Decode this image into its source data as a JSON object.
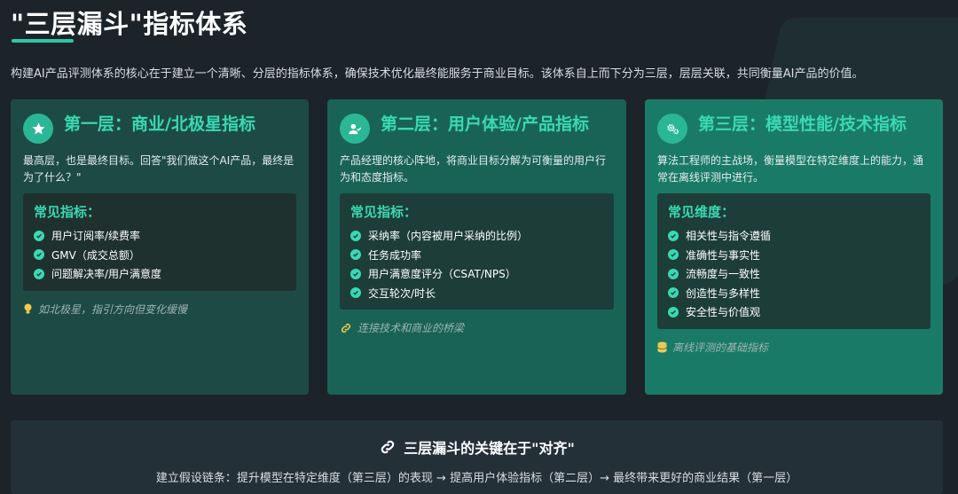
{
  "header": {
    "title": "\"三层漏斗\"指标体系",
    "intro": "构建AI产品评测体系的核心在于建立一个清晰、分层的指标体系，确保技术优化最终能服务于商业目标。该体系自上而下分为三层，层层关联，共同衡量AI产品的价值。"
  },
  "colors": {
    "accent": "#39d9b3",
    "layer1": "#1d4a45",
    "layer2": "#196356",
    "layer3": "#1a7a68"
  },
  "layers": [
    {
      "icon": "star-icon",
      "title": "第一层：商业/北极星指标",
      "desc": "最高层，也是最终目标。回答\"我们做这个AI产品，最终是为了什么？\"",
      "box_title": "常见指标：",
      "items": [
        "用户订阅率/续费率",
        "GMV（成交总额）",
        "问题解决率/用户满意度"
      ],
      "note_icon": "lightbulb-icon",
      "note": "如北极星，指引方向但变化缓慢"
    },
    {
      "icon": "user-check-icon",
      "title": "第二层：用户体验/产品指标",
      "desc": "产品经理的核心阵地，将商业目标分解为可衡量的用户行为和态度指标。",
      "box_title": "常见指标：",
      "items": [
        "采纳率（内容被用户采纳的比例）",
        "任务成功率",
        "用户满意度评分（CSAT/NPS）",
        "交互轮次/时长"
      ],
      "note_icon": "link-icon",
      "note": "连接技术和商业的桥梁"
    },
    {
      "icon": "gears-icon",
      "title": "第三层：模型性能/技术指标",
      "desc": "算法工程师的主战场，衡量模型在特定维度上的能力，通常在离线评测中进行。",
      "box_title": "常见维度：",
      "items": [
        "相关性与指令遵循",
        "准确性与事实性",
        "流畅度与一致性",
        "创造性与多样性",
        "安全性与价值观"
      ],
      "note_icon": "database-icon",
      "note": "离线评测的基础指标"
    }
  ],
  "footer": {
    "icon": "link-icon",
    "title": "三层漏斗的关键在于\"对齐\"",
    "text": "建立假设链条：提升模型在特定维度（第三层）的表现 → 提高用户体验指标（第二层）→ 最终带来更好的商业结果（第一层）"
  }
}
